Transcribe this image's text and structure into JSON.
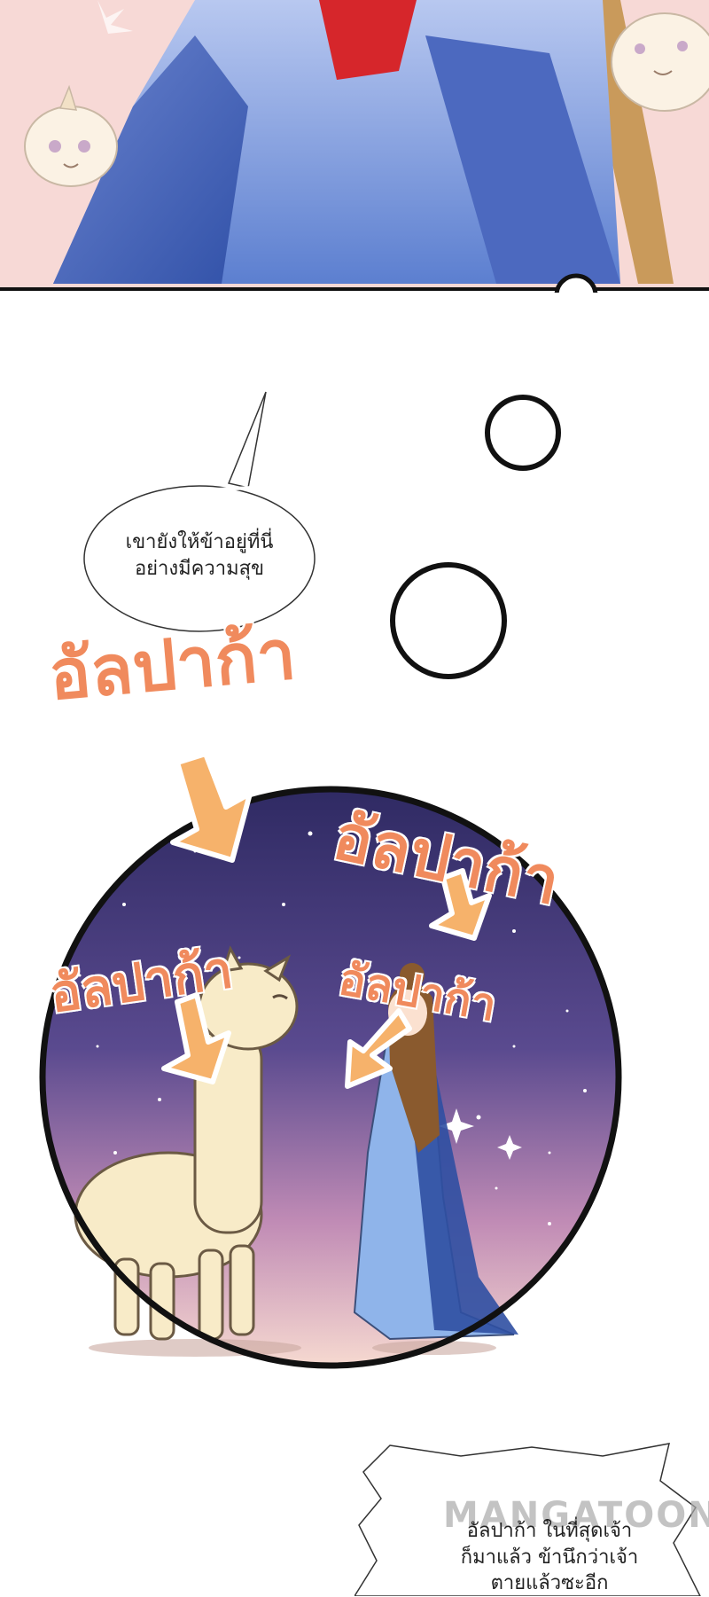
{
  "top_panel": {
    "content": "illustrated character in blue robe with cat-like creatures on pink background"
  },
  "speech_bubble_1": {
    "line1": "เขายังให้ข้าอยู่ที่นี่",
    "line2": "อย่างมีความสุข"
  },
  "shouts": {
    "big_left": "อัลปาก้า",
    "big_right": "อัลปาก้า",
    "mid_left": "อัลปาก้า",
    "mid_right": "อัลปาก้า"
  },
  "speech_bubble_2": {
    "line1": "อัลปาก้า ในที่สุดเจ้า",
    "line2": "ก็มาแล้ว ข้านึกว่าเจ้า",
    "line3": "ตายแล้วซะอีก"
  },
  "watermark": "MANGATOON",
  "colors": {
    "shout": "#f08a5d",
    "arrow": "#f6b26b",
    "night_top": "#2f2a63",
    "night_bottom": "#f3c9c9",
    "robe": "#8fb4ea",
    "panel_pink": "#f7d9d6"
  }
}
